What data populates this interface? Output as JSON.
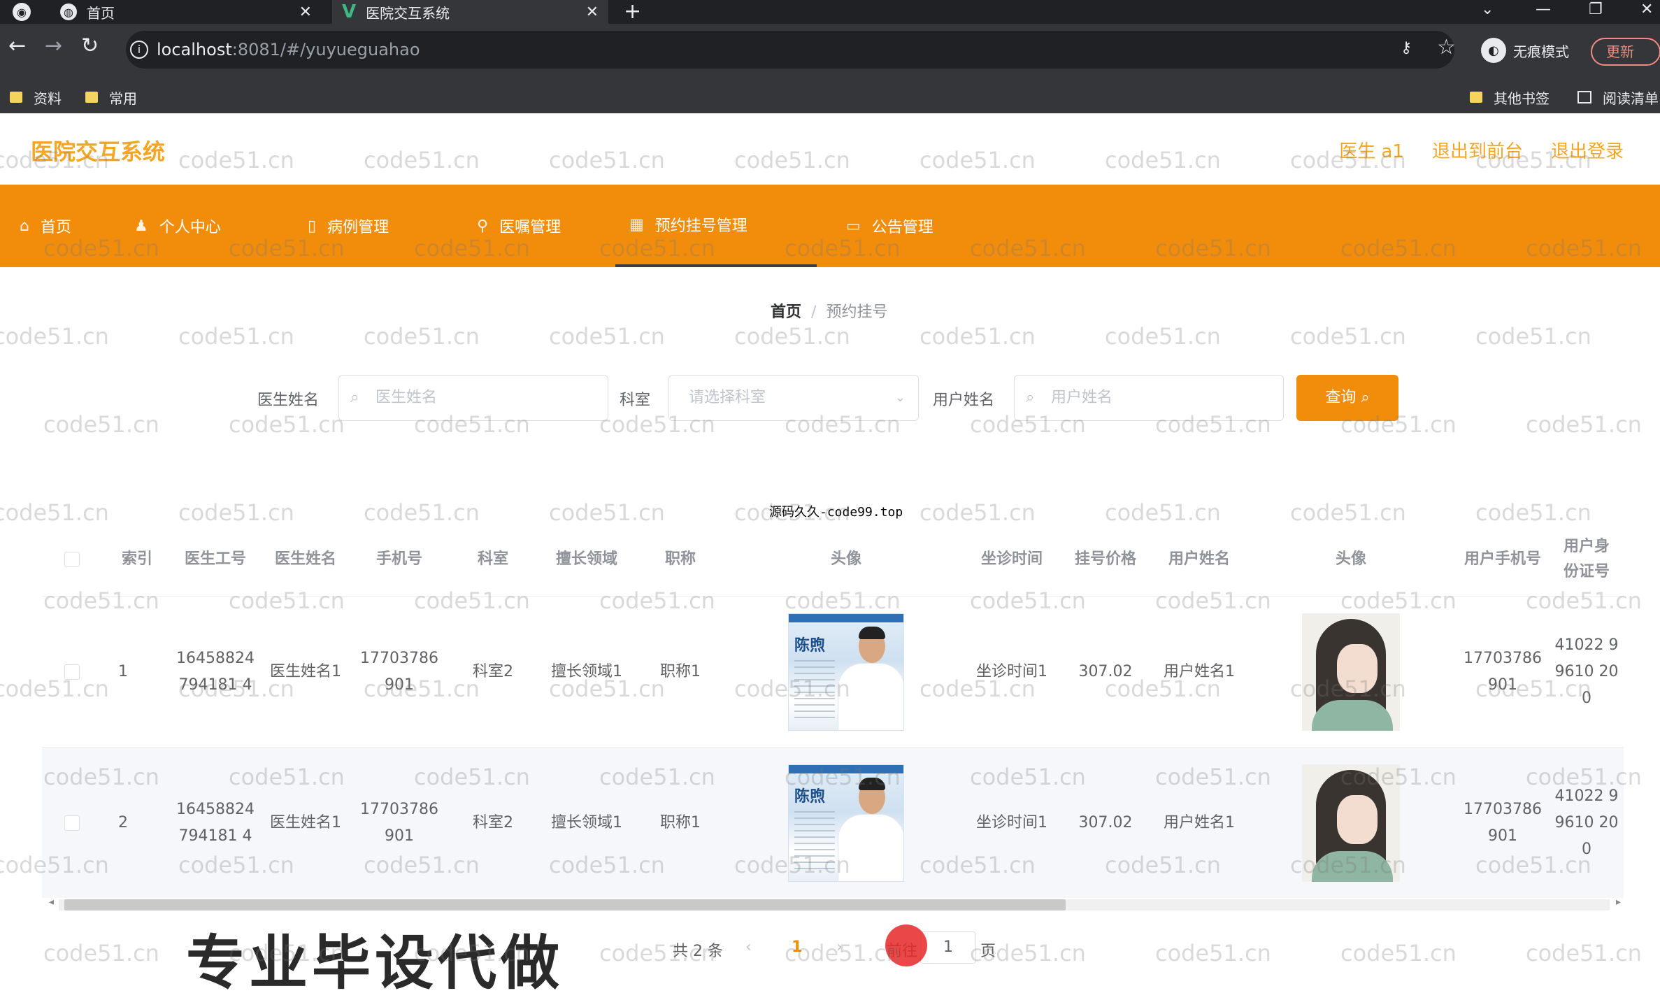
{
  "browser": {
    "tabs": [
      {
        "title": "首页",
        "icon": "globe-icon"
      },
      {
        "title": "医院交互系统",
        "icon": "vue-logo-icon"
      }
    ],
    "url_host": "localhost",
    "url_path": ":8081/#/yuyueguahao",
    "incognito_label": "无痕模式",
    "update_label": "更新",
    "bookmarks": [
      "资料",
      "常用"
    ],
    "bookmarks_right": [
      "其他书签",
      "阅读清单"
    ]
  },
  "header": {
    "logo": "医院交互系统",
    "links": [
      "医生 a1",
      "退出到前台",
      "退出登录"
    ]
  },
  "menu": {
    "items": [
      {
        "label": "首页",
        "icon": "home-icon"
      },
      {
        "label": "个人中心",
        "icon": "user-icon"
      },
      {
        "label": "病例管理",
        "icon": "file-icon"
      },
      {
        "label": "医嘱管理",
        "icon": "pin-icon"
      },
      {
        "label": "预约挂号管理",
        "icon": "calendar-icon"
      },
      {
        "label": "公告管理",
        "icon": "notice-icon"
      }
    ],
    "active": "预约挂号管理"
  },
  "breadcrumb": {
    "home": "首页",
    "current": "预约挂号"
  },
  "filters": {
    "doctor_label": "医生姓名",
    "doctor_placeholder": "医生姓名",
    "dept_label": "科室",
    "dept_placeholder": "请选择科室",
    "user_label": "用户姓名",
    "user_placeholder": "用户姓名",
    "query_label": "查询"
  },
  "note": "源码久久-code99.top",
  "table": {
    "columns": [
      "索引",
      "医生工号",
      "医生姓名",
      "手机号",
      "科室",
      "擅长领域",
      "职称",
      "头像",
      "坐诊时间",
      "挂号价格",
      "用户姓名",
      "头像",
      "用户手机号",
      "用户身份证号"
    ],
    "rows": [
      {
        "index": "1",
        "doctor_no": "16458824794181 4",
        "doctor_name": "医生姓名1",
        "phone": "17703786901",
        "dept": "科室2",
        "field": "擅长领域1",
        "title": "职称1",
        "schedule": "坐诊时间1",
        "price": "307.02",
        "user_name": "用户姓名1",
        "user_phone": "17703786901",
        "id_card": "41022 99610 200"
      },
      {
        "index": "2",
        "doctor_no": "16458824794181 4",
        "doctor_name": "医生姓名1",
        "phone": "17703786901",
        "dept": "科室2",
        "field": "擅长领域1",
        "title": "职称1",
        "schedule": "坐诊时间1",
        "price": "307.02",
        "user_name": "用户姓名1",
        "user_phone": "17703786901",
        "id_card": "41022 99610 200"
      }
    ],
    "doctor_photo_name": "陈煦"
  },
  "pager": {
    "total": "共 2 条",
    "current": "1",
    "goto": "前往",
    "page_input": "1",
    "page_word": "页"
  },
  "overlay": "专业毕设代做",
  "watermark": "code51.cn"
}
